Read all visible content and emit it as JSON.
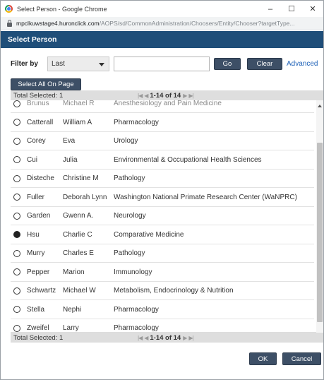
{
  "window": {
    "title": "Select Person - Google Chrome",
    "controls": {
      "minimize": "–",
      "maximize": "☐",
      "close": "✕"
    }
  },
  "urlbar": {
    "host": "mpclkuwstage4.huronclick.com",
    "path": "/AOPS/sd/CommonAdministration/Choosers/Entity/Chooser?targetType..."
  },
  "header": {
    "title": "Select Person"
  },
  "filter": {
    "label": "Filter by",
    "select_value": "Last",
    "input_value": "",
    "go_label": "Go",
    "clear_label": "Clear",
    "advanced_label": "Advanced"
  },
  "select_all_label": "Select All On Page",
  "total_top": {
    "label": "Total Selected: 1",
    "pager": "1-14 of 14"
  },
  "total_bottom": {
    "label": "Total Selected: 1",
    "pager": "1-14 of 14"
  },
  "rows": [
    {
      "last": "Brunus",
      "first": "Michael R",
      "dept": "Anesthesiology and Pain Medicine",
      "selected": false
    },
    {
      "last": "Catterall",
      "first": "William A",
      "dept": "Pharmacology",
      "selected": false
    },
    {
      "last": "Corey",
      "first": "Eva",
      "dept": "Urology",
      "selected": false
    },
    {
      "last": "Cui",
      "first": "Julia",
      "dept": "Environmental & Occupational Health Sciences",
      "selected": false
    },
    {
      "last": "Disteche",
      "first": "Christine M",
      "dept": "Pathology",
      "selected": false
    },
    {
      "last": "Fuller",
      "first": "Deborah Lynn",
      "dept": "Washington National Primate Research Center (WaNPRC)",
      "selected": false
    },
    {
      "last": "Garden",
      "first": "Gwenn A.",
      "dept": "Neurology",
      "selected": false
    },
    {
      "last": "Hsu",
      "first": "Charlie C",
      "dept": "Comparative Medicine",
      "selected": true
    },
    {
      "last": "Murry",
      "first": "Charles E",
      "dept": "Pathology",
      "selected": false
    },
    {
      "last": "Pepper",
      "first": "Marion",
      "dept": "Immunology",
      "selected": false
    },
    {
      "last": "Schwartz",
      "first": "Michael W",
      "dept": "Metabolism, Endocrinology & Nutrition",
      "selected": false
    },
    {
      "last": "Stella",
      "first": "Nephi",
      "dept": "Pharmacology",
      "selected": false
    },
    {
      "last": "Zweifel",
      "first": "Larry",
      "dept": "Pharmacology",
      "selected": false
    }
  ],
  "footer": {
    "ok_label": "OK",
    "cancel_label": "Cancel"
  },
  "colors": {
    "header_bg": "#1f4e79",
    "button_bg": "#3d4f66",
    "link": "#1f62b8"
  }
}
